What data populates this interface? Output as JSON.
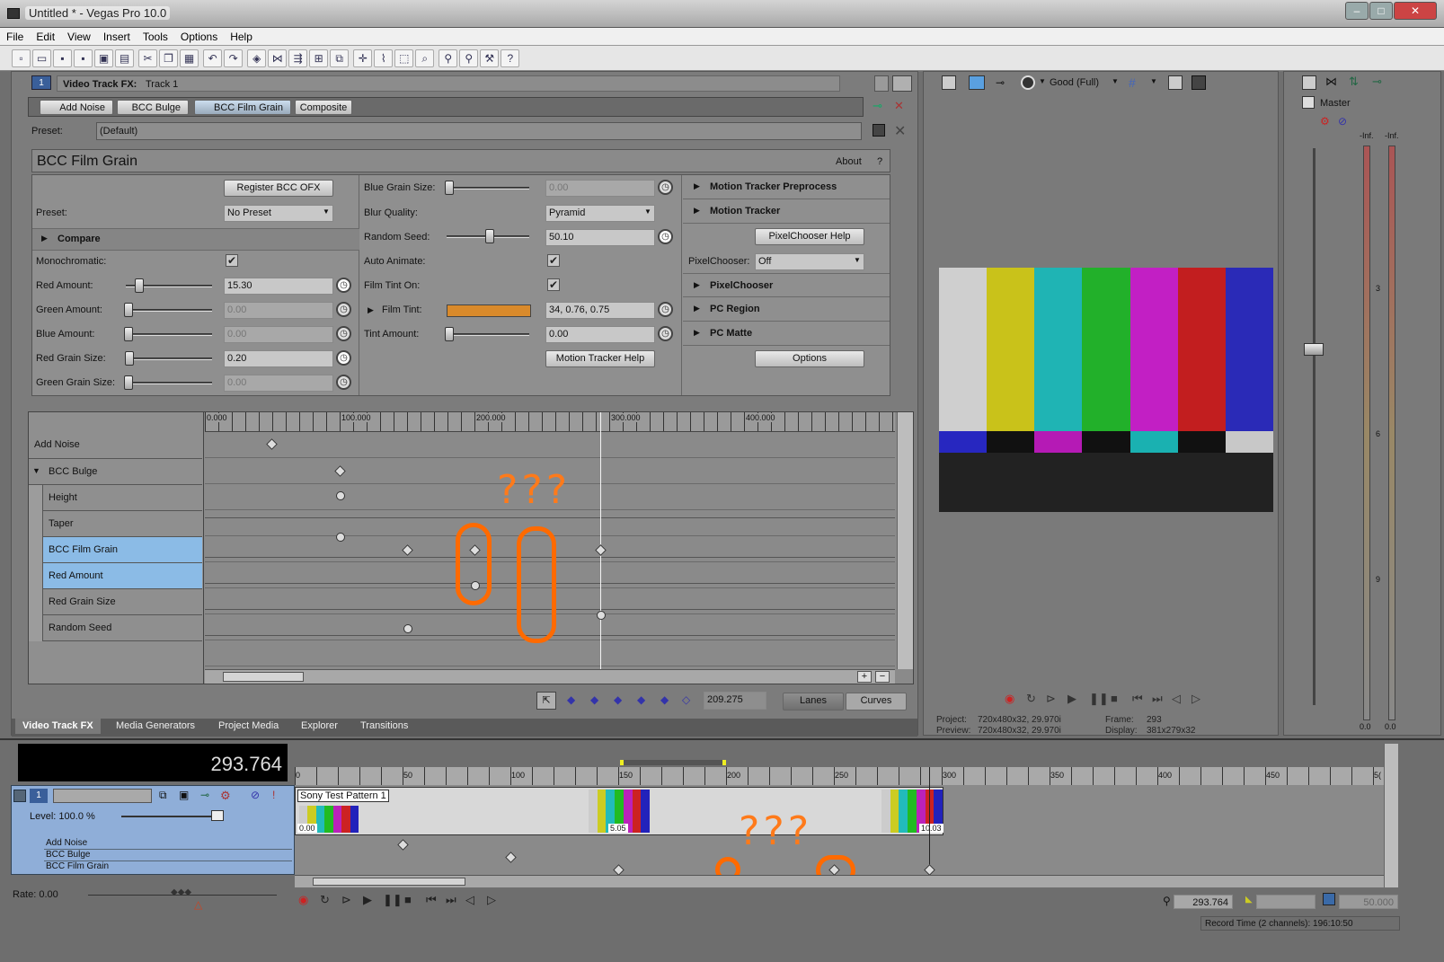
{
  "window": {
    "title": "Untitled * - Vegas Pro 10.0",
    "min": "–",
    "max": "□",
    "close": "✕"
  },
  "menu": [
    "File",
    "Edit",
    "View",
    "Insert",
    "Tools",
    "Options",
    "Help"
  ],
  "fx_header": {
    "track_num": "1",
    "title": "Video Track FX:",
    "track": "Track 1"
  },
  "fx_chain": [
    "Add Noise",
    "BCC Bulge",
    "BCC Film Grain",
    "Composite"
  ],
  "preset": {
    "label": "Preset:",
    "value": "(Default)"
  },
  "plugin": {
    "title": "BCC Film Grain",
    "about": "About",
    "help": "?"
  },
  "col1": {
    "register": "Register BCC OFX",
    "preset_label": "Preset:",
    "preset_value": "No Preset",
    "compare": "Compare",
    "mono": "Monochromatic:",
    "red_amount": "Red Amount:",
    "red_amount_val": "15.30",
    "green_amount": "Green Amount:",
    "green_amount_val": "0.00",
    "blue_amount": "Blue Amount:",
    "blue_amount_val": "0.00",
    "red_grain": "Red Grain Size:",
    "red_grain_val": "0.20",
    "green_grain": "Green Grain Size:",
    "green_grain_val": "0.00"
  },
  "col2": {
    "blue_grain": "Blue Grain Size:",
    "blue_grain_val": "0.00",
    "blur_q": "Blur Quality:",
    "blur_q_val": "Pyramid",
    "seed": "Random Seed:",
    "seed_val": "50.10",
    "auto": "Auto Animate:",
    "tint_on": "Film Tint On:",
    "tint": "Film Tint:",
    "tint_val": "34, 0.76, 0.75",
    "tint_color": "#d98a2b",
    "tint_amt": "Tint Amount:",
    "tint_amt_val": "0.00",
    "mt_help": "Motion Tracker Help"
  },
  "col3": {
    "mtp": "Motion Tracker Preprocess",
    "mt": "Motion Tracker",
    "pc_help": "PixelChooser Help",
    "pc_label": "PixelChooser:",
    "pc_val": "Off",
    "pc": "PixelChooser",
    "pcr": "PC Region",
    "pcm": "PC Matte",
    "options": "Options"
  },
  "kf_ruler": [
    "0.000",
    "100.000",
    "200.000",
    "300.000",
    "400.000"
  ],
  "kf_lanes": [
    "Add Noise",
    "BCC Bulge",
    "Height",
    "Taper",
    "BCC Film Grain",
    "Red Amount",
    "Red Grain Size",
    "Random Seed"
  ],
  "annot": "???",
  "kf_time": "209.275",
  "kf_modes": [
    "Lanes",
    "Curves"
  ],
  "dock_tabs": [
    "Video Track FX",
    "Media Generators",
    "Project Media",
    "Explorer",
    "Transitions"
  ],
  "preview": {
    "quality": "Good (Full)",
    "project_label": "Project:",
    "project_val": "720x480x32, 29.970i",
    "preview_label": "Preview:",
    "preview_val": "720x480x32, 29.970i",
    "frame_label": "Frame:",
    "frame_val": "293",
    "display_label": "Display:",
    "display_val": "381x279x32"
  },
  "master": {
    "title": "Master",
    "inf_l": "-Inf.",
    "inf_r": "-Inf.",
    "t3": "3",
    "t6": "6",
    "t9": "9",
    "bot_l": "0.0",
    "bot_r": "0.0"
  },
  "timeline": {
    "time": "293.764",
    "track_num": "1",
    "level": "Level: 100.0 %",
    "fx_rows": [
      "Add Noise",
      "BCC Bulge",
      "BCC Film Grain"
    ],
    "ruler": [
      "0",
      "50",
      "100",
      "150",
      "200",
      "250",
      "300",
      "350",
      "400",
      "450",
      "5("
    ],
    "clip": "Sony Test Pattern 1",
    "clip_t1": "0.00",
    "clip_t2": "5.05",
    "clip_t3": "10.03",
    "rate": "Rate: 0.00",
    "pos": "293.764",
    "rate2": "50.000",
    "record": "Record Time (2 channels): 196:10:50"
  }
}
